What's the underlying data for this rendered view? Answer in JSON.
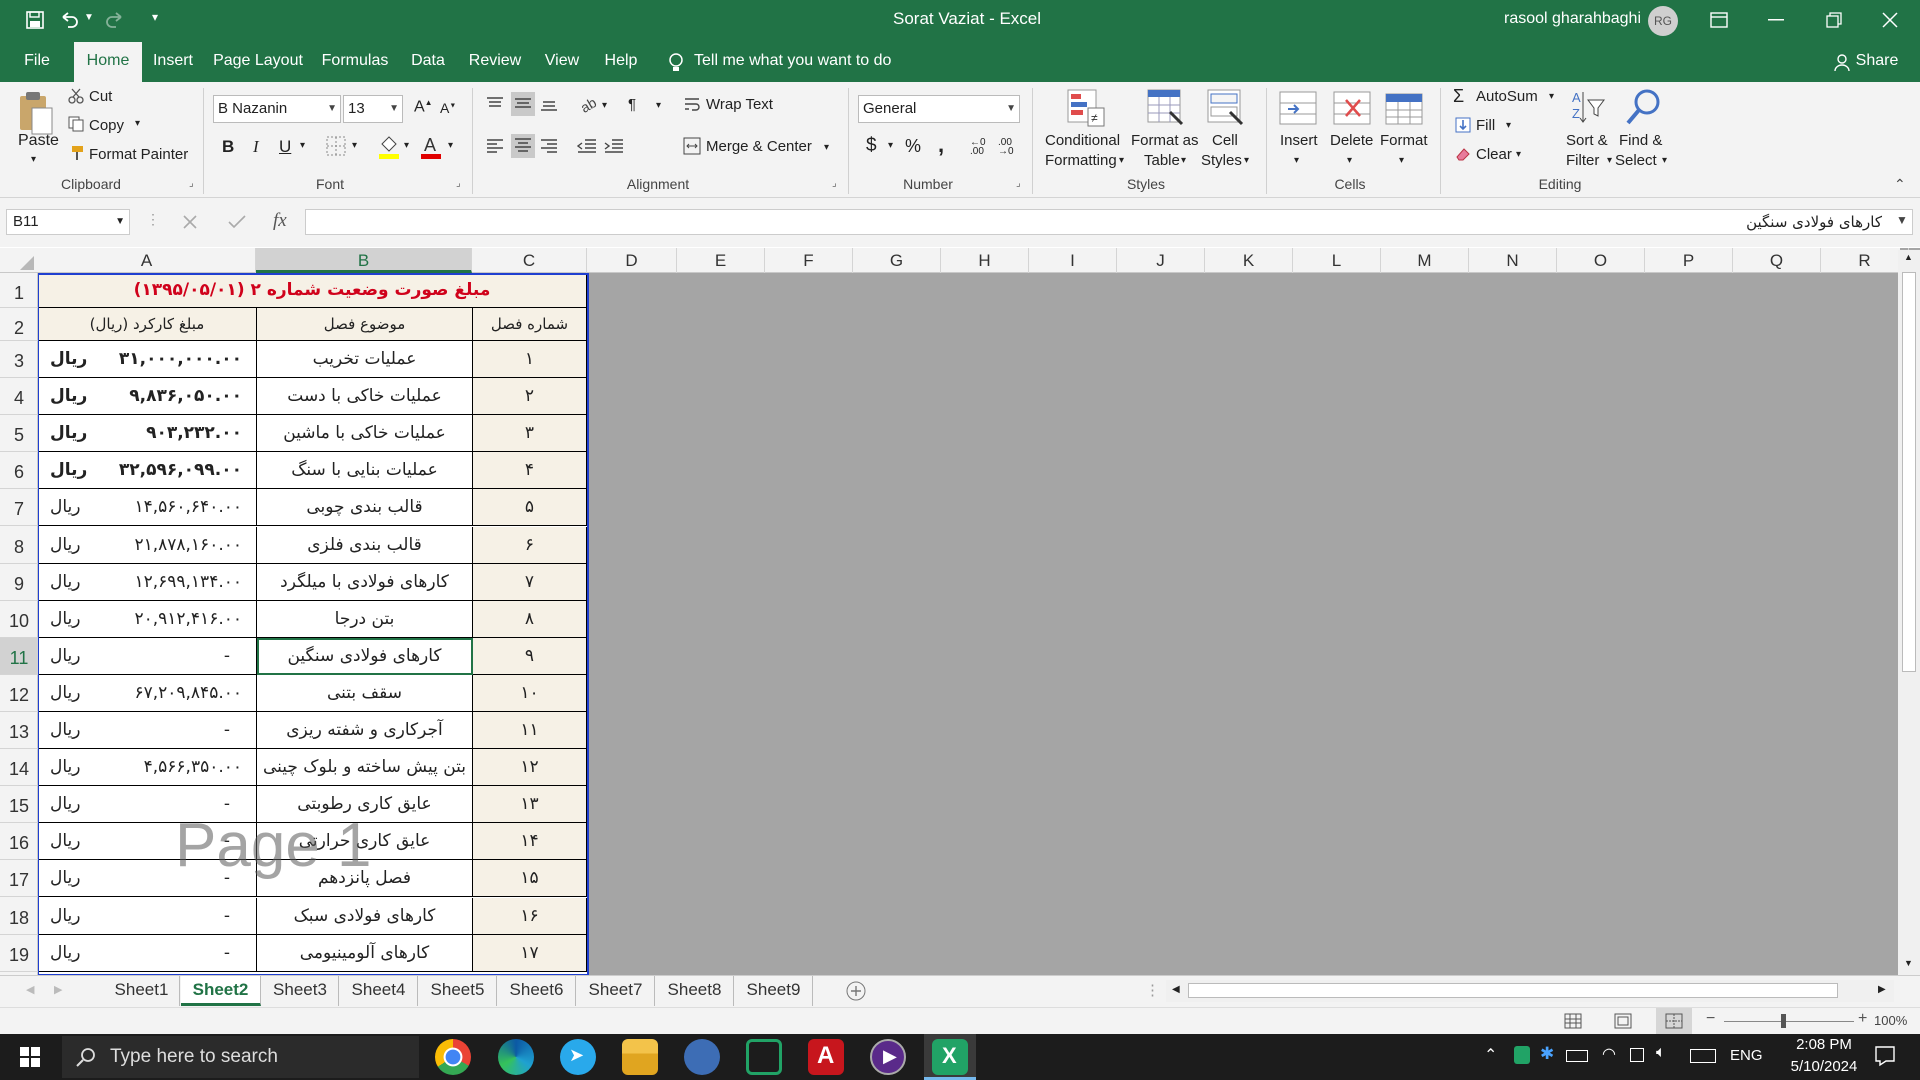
{
  "window": {
    "title": "Sorat Vaziat  -  Excel",
    "user_name": "rasool gharahbaghi",
    "user_initials": "RG"
  },
  "quick_access": {
    "save_icon": "save-icon",
    "undo_icon": "undo-icon",
    "redo_icon": "redo-icon"
  },
  "ribbon_tabs": [
    "File",
    "Home",
    "Insert",
    "Page Layout",
    "Formulas",
    "Data",
    "Review",
    "View",
    "Help"
  ],
  "active_tab": "Home",
  "tell_me": "Tell me what you want to do",
  "share": "Share",
  "clipboard": {
    "paste": "Paste",
    "cut": "Cut",
    "copy": "Copy",
    "format_painter": "Format Painter",
    "label": "Clipboard"
  },
  "font": {
    "name": "B Nazanin",
    "size": "13",
    "bold": "B",
    "italic": "I",
    "underline": "U",
    "label": "Font"
  },
  "alignment": {
    "wrap_text": "Wrap Text",
    "merge_center": "Merge & Center",
    "label": "Alignment"
  },
  "number": {
    "format": "General",
    "currency": "$",
    "percent": "%",
    "comma": ",",
    "label": "Number"
  },
  "styles": {
    "conditional": "Conditional",
    "conditional2": "Formatting",
    "format_as": "Format as",
    "format_as2": "Table",
    "cell": "Cell",
    "cell2": "Styles",
    "label": "Styles"
  },
  "cells": {
    "insert": "Insert",
    "delete": "Delete",
    "format": "Format",
    "label": "Cells"
  },
  "editing": {
    "autosum": "AutoSum",
    "fill": "Fill",
    "clear": "Clear",
    "sort": "Sort &",
    "sort2": "Filter",
    "find": "Find &",
    "find2": "Select",
    "label": "Editing"
  },
  "name_box": "B11",
  "formula_value": "کارهای فولادی سنگین",
  "fx": "fx",
  "columns": [
    "A",
    "B",
    "C",
    "D",
    "E",
    "F",
    "G",
    "H",
    "I",
    "J",
    "K",
    "L",
    "M",
    "N",
    "O",
    "P",
    "Q",
    "R"
  ],
  "rows": [
    "1",
    "2",
    "3",
    "4",
    "5",
    "6",
    "7",
    "8",
    "9",
    "10",
    "11",
    "12",
    "13",
    "14",
    "15",
    "16",
    "17",
    "18",
    "19"
  ],
  "table": {
    "title": "مبلغ صورت وضعیت شماره ۲  (۱۳۹۵/۰۵/۰۱)",
    "headers": {
      "amount": "مبلغ کارکرد (ریال)",
      "subject": "موضوع فصل",
      "number": "شماره فصل"
    },
    "rows": [
      {
        "unit": "ریال",
        "amount": "۳۱,۰۰۰,۰۰۰.۰۰",
        "subject": "عملیات تخریب",
        "num": "۱",
        "bold": true
      },
      {
        "unit": "ریال",
        "amount": "۹,۸۳۶,۰۵۰.۰۰",
        "subject": "عملیات خاکی با دست",
        "num": "۲",
        "bold": true
      },
      {
        "unit": "ریال",
        "amount": "۹۰۳,۲۳۲.۰۰",
        "subject": "عملیات خاکی با ماشین",
        "num": "۳",
        "bold": true
      },
      {
        "unit": "ریال",
        "amount": "۳۲,۵۹۶,۰۹۹.۰۰",
        "subject": "عملیات بنایی با سنگ",
        "num": "۴",
        "bold": true
      },
      {
        "unit": "ریال",
        "amount": "۱۴,۵۶۰,۶۴۰.۰۰",
        "subject": "قالب بندی چوبی",
        "num": "۵",
        "bold": false
      },
      {
        "unit": "ریال",
        "amount": "۲۱,۸۷۸,۱۶۰.۰۰",
        "subject": "قالب بندی فلزی",
        "num": "۶",
        "bold": false
      },
      {
        "unit": "ریال",
        "amount": "۱۲,۶۹۹,۱۳۴.۰۰",
        "subject": "کارهای فولادی با میلگرد",
        "num": "۷",
        "bold": false
      },
      {
        "unit": "ریال",
        "amount": "۲۰,۹۱۲,۴۱۶.۰۰",
        "subject": "بتن درجا",
        "num": "۸",
        "bold": false
      },
      {
        "unit": "ریال",
        "amount": "-",
        "subject": "کارهای فولادی سنگین",
        "num": "۹",
        "bold": false
      },
      {
        "unit": "ریال",
        "amount": "۶۷,۲۰۹,۸۴۵.۰۰",
        "subject": "سقف بتنی",
        "num": "۱۰",
        "bold": false
      },
      {
        "unit": "ریال",
        "amount": "-",
        "subject": "آجرکاری و شفته ریزی",
        "num": "۱۱",
        "bold": false
      },
      {
        "unit": "ریال",
        "amount": "۴,۵۶۶,۳۵۰.۰۰",
        "subject": "بتن پیش ساخته و بلوک چینی",
        "num": "۱۲",
        "bold": false
      },
      {
        "unit": "ریال",
        "amount": "-",
        "subject": "عایق کاری رطوبتی",
        "num": "۱۳",
        "bold": false
      },
      {
        "unit": "ریال",
        "amount": "-",
        "subject": "عایق کاری حرارتی",
        "num": "۱۴",
        "bold": false
      },
      {
        "unit": "ریال",
        "amount": "-",
        "subject": "فصل پانزدهم",
        "num": "۱۵",
        "bold": false
      },
      {
        "unit": "ریال",
        "amount": "-",
        "subject": "کارهای فولادی سبک",
        "num": "۱۶",
        "bold": false
      },
      {
        "unit": "ریال",
        "amount": "-",
        "subject": "کارهای آلومینیومی",
        "num": "۱۷",
        "bold": false
      }
    ]
  },
  "page_watermark": "Page 1",
  "sheet_tabs": [
    "Sheet1",
    "Sheet2",
    "Sheet3",
    "Sheet4",
    "Sheet5",
    "Sheet6",
    "Sheet7",
    "Sheet8",
    "Sheet9"
  ],
  "active_sheet": "Sheet2",
  "zoom": "100%",
  "taskbar": {
    "search_placeholder": "Type here to search",
    "apps": [
      "chrome-icon",
      "edge-icon",
      "telegram-icon",
      "file-explorer-icon",
      "app-icon",
      "terminal-icon",
      "acrobat-icon",
      "media-player-icon",
      "excel-icon"
    ],
    "lang": "ENG",
    "time": "2:08 PM",
    "date": "5/10/2024"
  },
  "colors": {
    "excel_green": "#217346",
    "title_red": "#d0021b",
    "border_blue": "#1f3fd0"
  }
}
